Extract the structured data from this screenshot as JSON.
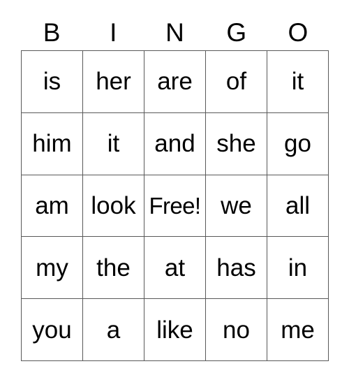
{
  "card": {
    "title": "BINGO",
    "header_letters": [
      "B",
      "I",
      "N",
      "G",
      "O"
    ],
    "free_space_label": "Free!",
    "free_space_position": {
      "row": 2,
      "col": 2
    },
    "grid_size": "5x5",
    "border_color": "#595959",
    "background_color": "#ffffff",
    "text_color": "#000000",
    "rows": [
      {
        "cells": [
          "is",
          "her",
          "are",
          "of",
          "it"
        ]
      },
      {
        "cells": [
          "him",
          "it",
          "and",
          "she",
          "go"
        ]
      },
      {
        "cells": [
          "am",
          "look",
          "Free!",
          "we",
          "all"
        ]
      },
      {
        "cells": [
          "my",
          "the",
          "at",
          "has",
          "in"
        ]
      },
      {
        "cells": [
          "you",
          "a",
          "like",
          "no",
          "me"
        ]
      }
    ]
  }
}
